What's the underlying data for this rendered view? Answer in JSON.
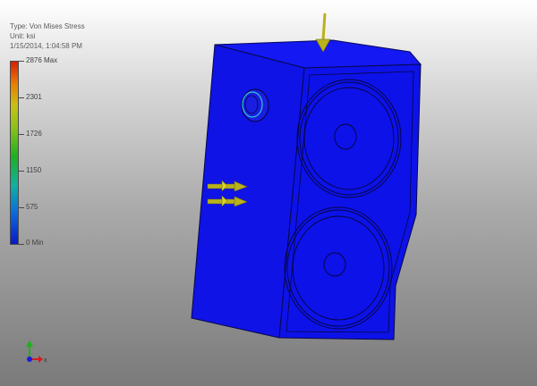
{
  "legend": {
    "type_label": "Type: Von Mises Stress",
    "unit_label": "Unit: ksi",
    "date_label": "1/15/2014, 1:04:58 PM",
    "ticks": [
      {
        "label": "2876 Max",
        "value": 2876
      },
      {
        "label": "2301",
        "value": 2301
      },
      {
        "label": "1726",
        "value": 1726
      },
      {
        "label": "1150",
        "value": 1150
      },
      {
        "label": "575",
        "value": 575
      },
      {
        "label": "0 Min",
        "value": 0
      }
    ]
  },
  "triad": {
    "x_label": "x"
  },
  "colors": {
    "model_fill": "#0d12e8",
    "load_arrow": "#b9b21c",
    "background_top": "#ffffff",
    "background_bottom": "#7a7a7a"
  },
  "icons": {
    "load_arrow": "load-arrow-icon",
    "triad": "axis-triad-icon"
  }
}
